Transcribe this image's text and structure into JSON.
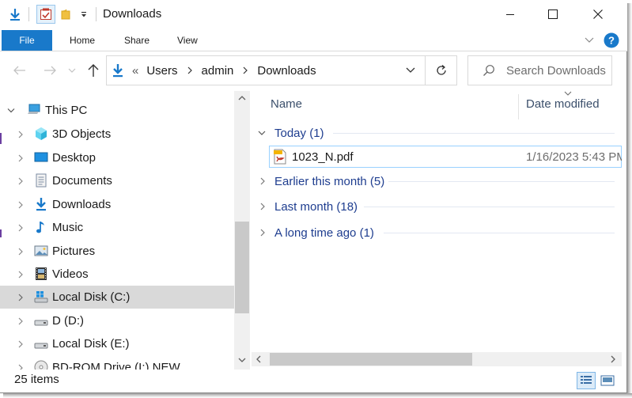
{
  "window": {
    "title": "Downloads"
  },
  "ribbon": {
    "tabs": [
      "File",
      "Home",
      "Share",
      "View"
    ]
  },
  "address": {
    "overflow": "«",
    "crumbs": [
      "Users",
      "admin",
      "Downloads"
    ]
  },
  "search": {
    "placeholder": "Search Downloads"
  },
  "navpane": {
    "items": [
      {
        "label": "This PC",
        "icon": "this-pc-icon"
      },
      {
        "label": "3D Objects",
        "icon": "3d-objects-icon"
      },
      {
        "label": "Desktop",
        "icon": "desktop-icon"
      },
      {
        "label": "Documents",
        "icon": "documents-icon"
      },
      {
        "label": "Downloads",
        "icon": "downloads-icon"
      },
      {
        "label": "Music",
        "icon": "music-icon"
      },
      {
        "label": "Pictures",
        "icon": "pictures-icon"
      },
      {
        "label": "Videos",
        "icon": "videos-icon"
      },
      {
        "label": "Local Disk (C:)",
        "icon": "local-disk-icon"
      },
      {
        "label": "D (D:)",
        "icon": "drive-icon"
      },
      {
        "label": "Local Disk (E:)",
        "icon": "drive-icon"
      },
      {
        "label": "BD-ROM Drive (I:) NEW",
        "icon": "bd-rom-icon"
      }
    ]
  },
  "content": {
    "columns": [
      "Name",
      "Date modified"
    ],
    "groups": [
      {
        "label": "Today (1)",
        "expanded": true
      },
      {
        "label": "Earlier this month (5)",
        "expanded": false
      },
      {
        "label": "Last month (18)",
        "expanded": false
      },
      {
        "label": "A long time ago (1)",
        "expanded": false
      }
    ],
    "files": [
      {
        "name": "1023_N.pdf",
        "date": "1/16/2023 5:43 PM",
        "icon": "pdf-file-icon"
      }
    ]
  },
  "status": {
    "item_count": "25 items"
  },
  "colors": {
    "accent": "#1979ca",
    "group_text": "#1e3d8f",
    "selection": "#d9d9d9"
  }
}
